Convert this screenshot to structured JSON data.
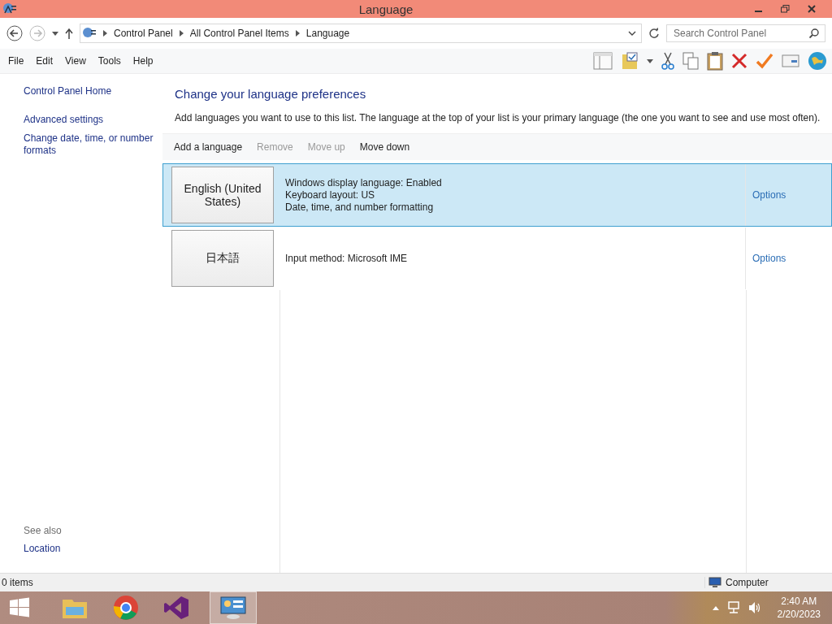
{
  "window": {
    "title": "Language"
  },
  "address_bar": {
    "breadcrumbs": [
      "Control Panel",
      "All Control Panel Items",
      "Language"
    ],
    "search_placeholder": "Search Control Panel"
  },
  "menu": [
    "File",
    "Edit",
    "View",
    "Tools",
    "Help"
  ],
  "sidebar": {
    "links": [
      "Control Panel Home",
      "Advanced settings",
      "Change date, time, or number formats"
    ],
    "see_also_heading": "See also",
    "see_also": [
      "Location"
    ]
  },
  "content": {
    "heading": "Change your language preferences",
    "description": "Add languages you want to use to this list. The language at the top of your list is your primary language (the one you want to see and use most often).",
    "actions": [
      {
        "label": "Add a language",
        "disabled": false
      },
      {
        "label": "Remove",
        "disabled": true
      },
      {
        "label": "Move up",
        "disabled": true
      },
      {
        "label": "Move down",
        "disabled": false
      }
    ],
    "languages": [
      {
        "name": "English (United States)",
        "details": [
          "Windows display language: Enabled",
          "Keyboard layout: US",
          "Date, time, and number formatting"
        ],
        "options": "Options",
        "selected": true
      },
      {
        "name": "日本語",
        "details": [
          "Input method: Microsoft IME"
        ],
        "options": "Options",
        "selected": false
      }
    ]
  },
  "status_bar": {
    "items": "0 items",
    "location": "Computer"
  },
  "taskbar": {
    "time": "2:40 AM",
    "date": "2/20/2023"
  }
}
